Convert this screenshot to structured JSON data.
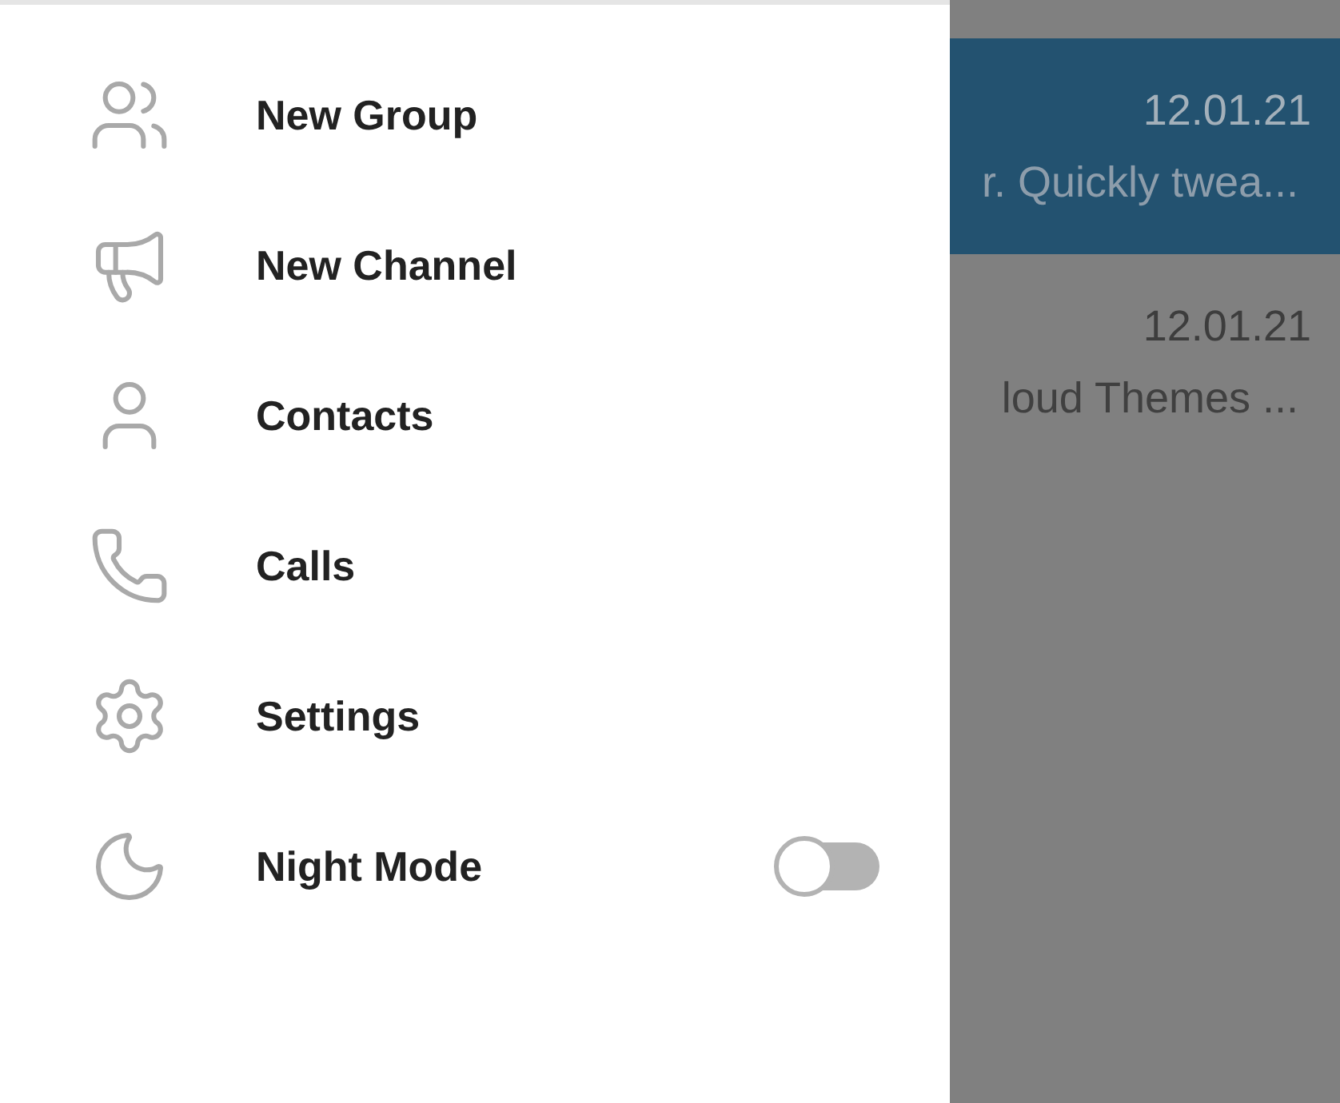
{
  "drawer": {
    "items": [
      {
        "kind": "action",
        "label": "New Group"
      },
      {
        "kind": "action",
        "label": "New Channel"
      },
      {
        "kind": "action",
        "label": "Contacts"
      },
      {
        "kind": "action",
        "label": "Calls"
      },
      {
        "kind": "action",
        "label": "Settings"
      },
      {
        "kind": "toggle",
        "label": "Night Mode",
        "on": false
      }
    ]
  },
  "chat_list": {
    "rows": [
      {
        "selected": true,
        "date": "12.01.21",
        "preview": "r. Quickly twea..."
      },
      {
        "selected": false,
        "date": "12.01.21",
        "preview": "loud Themes ..."
      }
    ]
  }
}
